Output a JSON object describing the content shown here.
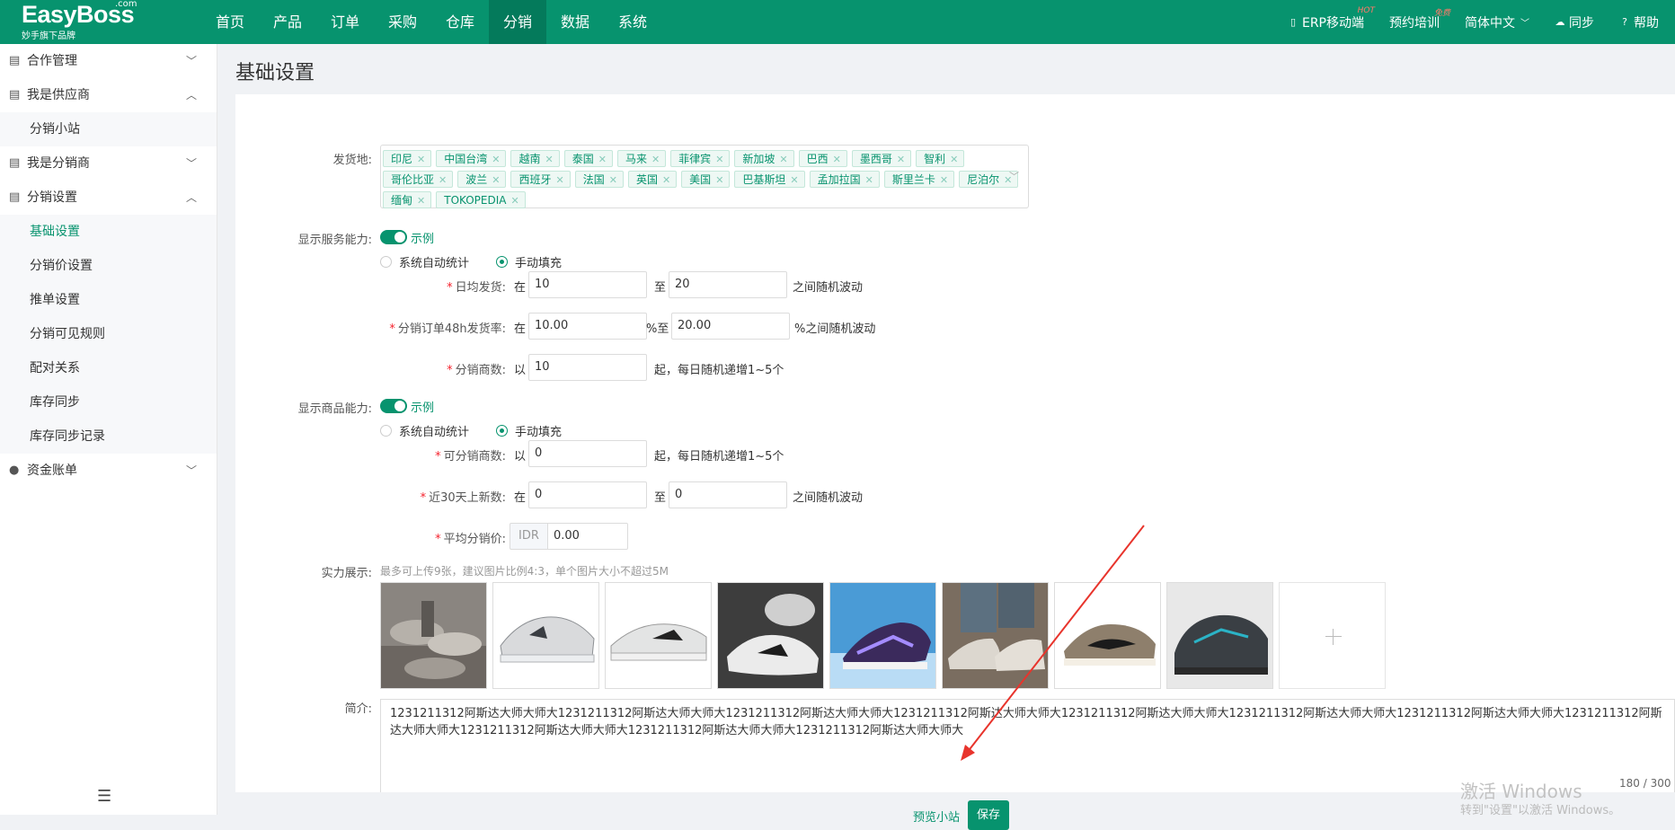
{
  "header": {
    "logo": "EasyBoss",
    "logo_com": ".com",
    "logo_sub": "妙手旗下品牌",
    "nav": [
      "首页",
      "产品",
      "订单",
      "采购",
      "仓库",
      "分销",
      "数据",
      "系统"
    ],
    "right": {
      "erp": "ERP移动端",
      "erp_badge": "HOT",
      "training": "预约培训",
      "training_badge": "免费",
      "lang": "简体中文",
      "sync": "同步",
      "help": "帮助"
    }
  },
  "sidebar": {
    "groups": [
      {
        "label": "合作管理",
        "open": false,
        "children": []
      },
      {
        "label": "我是供应商",
        "open": true,
        "children": [
          "分销小站"
        ]
      },
      {
        "label": "我是分销商",
        "open": false,
        "children": []
      },
      {
        "label": "分销设置",
        "open": true,
        "children": [
          "基础设置",
          "分销价设置",
          "推单设置",
          "分销可见规则",
          "配对关系",
          "库存同步",
          "库存同步记录"
        ]
      },
      {
        "label": "资金账单",
        "open": false,
        "children": []
      }
    ],
    "active_child": "基础设置"
  },
  "page": {
    "title": "基础设置",
    "ship_from": {
      "label": "发货地:",
      "tags": [
        "印尼",
        "中国台湾",
        "越南",
        "泰国",
        "马来",
        "菲律宾",
        "新加坡",
        "巴西",
        "墨西哥",
        "智利",
        "哥伦比亚",
        "波兰",
        "西班牙",
        "法国",
        "英国",
        "美国",
        "巴基斯坦",
        "孟加拉国",
        "斯里兰卡",
        "尼泊尔",
        "缅甸",
        "TOKOPEDIA"
      ]
    },
    "service": {
      "label": "显示服务能力:",
      "example": "示例",
      "radio_auto": "系统自动统计",
      "radio_manual": "手动填充",
      "daily_label": "日均发货:",
      "daily_prefix": "在",
      "daily_from": "10",
      "daily_mid": "至",
      "daily_to": "20",
      "daily_suffix": "之间随机波动",
      "rate_label": "分销订单48h发货率:",
      "rate_prefix": "在",
      "rate_from": "10.00",
      "rate_mid": "%至",
      "rate_to": "20.00",
      "rate_suffix": "%之间随机波动",
      "dist_label": "分销商数:",
      "dist_prefix": "以",
      "dist_value": "10",
      "dist_suffix": "起，每日随机递增1~5个"
    },
    "goods": {
      "label": "显示商品能力:",
      "example": "示例",
      "radio_auto": "系统自动统计",
      "radio_manual": "手动填充",
      "cnt_label": "可分销商数:",
      "cnt_prefix": "以",
      "cnt_value": "0",
      "cnt_suffix": "起，每日随机递增1~5个",
      "new_label": "近30天上新数:",
      "new_prefix": "在",
      "new_from": "0",
      "new_mid": "至",
      "new_to": "0",
      "new_suffix": "之间随机波动",
      "price_label": "平均分销价:",
      "price_currency": "IDR",
      "price_value": "0.00"
    },
    "showcase": {
      "label": "实力展示:",
      "hint": "最多可上传9张，建议图片比例4:3，单个图片大小不超过5M"
    },
    "intro": {
      "label": "简介:",
      "text": "1231211312阿斯达大师大师大1231211312阿斯达大师大师大1231211312阿斯达大师大师大1231211312阿斯达大师大师大1231211312阿斯达大师大师大1231211312阿斯达大师大师大1231211312阿斯达大师大师大1231211312阿斯达大师大师大1231211312阿斯达大师大师大1231211312阿斯达大师大师大1231211312阿斯达大师大师大",
      "count": "180 / 300"
    },
    "watermark": {
      "line1": "激活 Windows",
      "line2": "转到\"设置\"以激活 Windows。"
    },
    "actions": {
      "preview": "预览小站",
      "save": "保存"
    }
  },
  "colors": {
    "brand": "#07936e",
    "nav_active": "#047a5b",
    "required": "#f5222d",
    "arrow": "#e8342c"
  }
}
